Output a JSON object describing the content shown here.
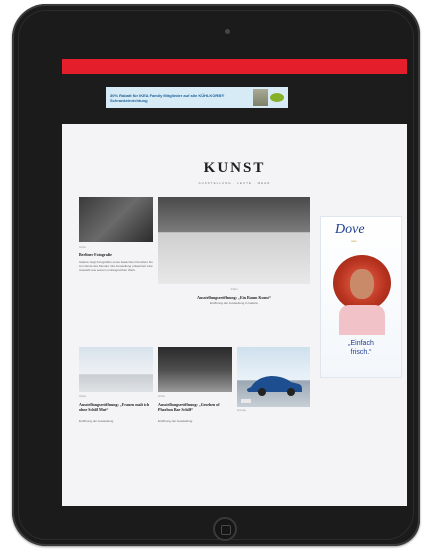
{
  "top_banner": {
    "text": "30% Rabatt für IKEA Family Mitglieder auf alle KÜHLKORB® Schrankeinrichtung"
  },
  "section": {
    "title": "KUNST",
    "subnav": "AUSSTELLUNG · LEUTE · MEHR"
  },
  "articles": [
    {
      "kicker": "Artikel",
      "headline": "Berliner Fotografie",
      "teaser": "Galerie zeigt Fotografien eines bekannten Künstlers bis zum Ende des Monats. Die Ausstellung präsentiert eine Auswahl aus seinem umfangreichen Werk."
    },
    {
      "kicker": "Artikel",
      "headline": "Ausstellungseröffnung: „Ein Raum Kunst“",
      "teaser": "Eröffnung der Ausstellung in Galerie"
    },
    {
      "kicker": "Artikel",
      "headline": "Ausstellungseröffnung: „Frauen malt ich ohne Schilf Mut“",
      "teaser": "Eröffnung der Ausstellung"
    },
    {
      "kicker": "Artikel",
      "headline": "Ausstellungseröffnung: „Gesehen of Pharbon Bae Schilf“",
      "teaser": "Eröffnung der Ausstellung"
    }
  ],
  "car_ad": {
    "badge": "Anzeige"
  },
  "dove_ad": {
    "brand": "Dove",
    "sub": "care",
    "slogan_line1": "„Einfach",
    "slogan_line2": "frisch.“"
  },
  "colors": {
    "accent_red": "#e41e2b",
    "header_dark": "#1c1c1c",
    "dove_blue": "#1d3f8f"
  }
}
